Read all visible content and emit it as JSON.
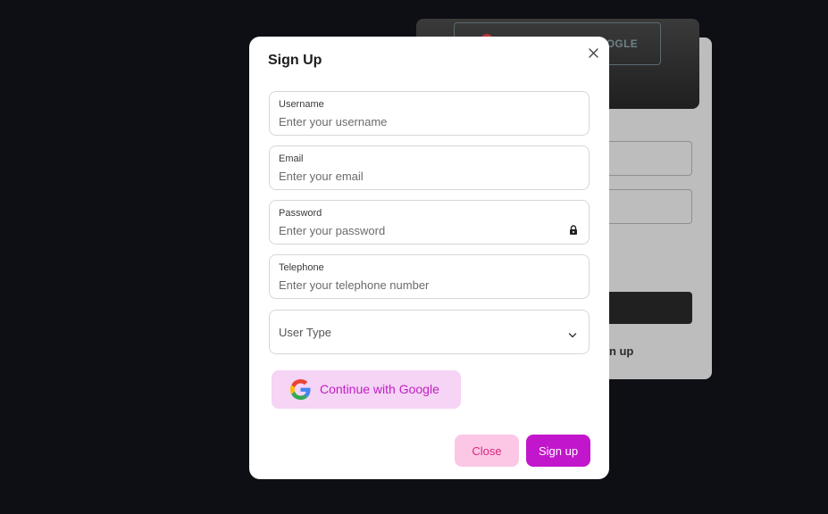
{
  "background": {
    "google_button_label": "OGLE",
    "signup_link": "gn up"
  },
  "modal": {
    "title": "Sign Up",
    "close_icon": "close-icon",
    "fields": {
      "username": {
        "label": "Username",
        "placeholder": "Enter your username"
      },
      "email": {
        "label": "Email",
        "placeholder": "Enter your email"
      },
      "password": {
        "label": "Password",
        "placeholder": "Enter your password",
        "icon": "lock-icon"
      },
      "telephone": {
        "label": "Telephone",
        "placeholder": "Enter your telephone number"
      }
    },
    "user_type": {
      "selected": "User Type",
      "icon": "chevron-down-icon"
    },
    "google_button": {
      "label": "Continue with Google",
      "icon": "google-icon"
    },
    "close_button": "Close",
    "signup_button": "Sign up"
  },
  "colors": {
    "page_background": "#0d0f14",
    "accent": "#c216cc",
    "google_button_bg": "#f5d4f5",
    "close_button_bg": "#fbc7e5",
    "close_button_text": "#d62a80"
  }
}
